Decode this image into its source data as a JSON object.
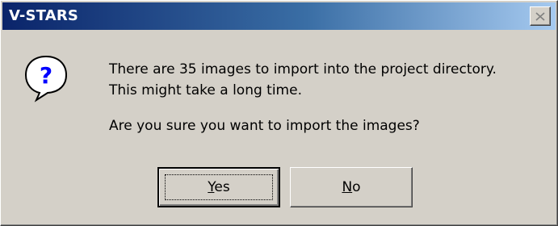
{
  "window": {
    "title": "V-STARS"
  },
  "message": {
    "line1": "There are 35 images to import into the project directory.",
    "line2": "This might take a long time.",
    "line3": "Are you sure you want to import the images?"
  },
  "buttons": {
    "yes": {
      "mnemonic": "Y",
      "rest": "es"
    },
    "no": {
      "mnemonic": "N",
      "rest": "o"
    }
  },
  "icons": {
    "dialog": "question-icon",
    "close": "close-icon"
  },
  "colors": {
    "titlebar_start": "#0a246a",
    "titlebar_end": "#a6caf0",
    "face": "#d4d0c8",
    "icon_blue": "#0000ff"
  }
}
